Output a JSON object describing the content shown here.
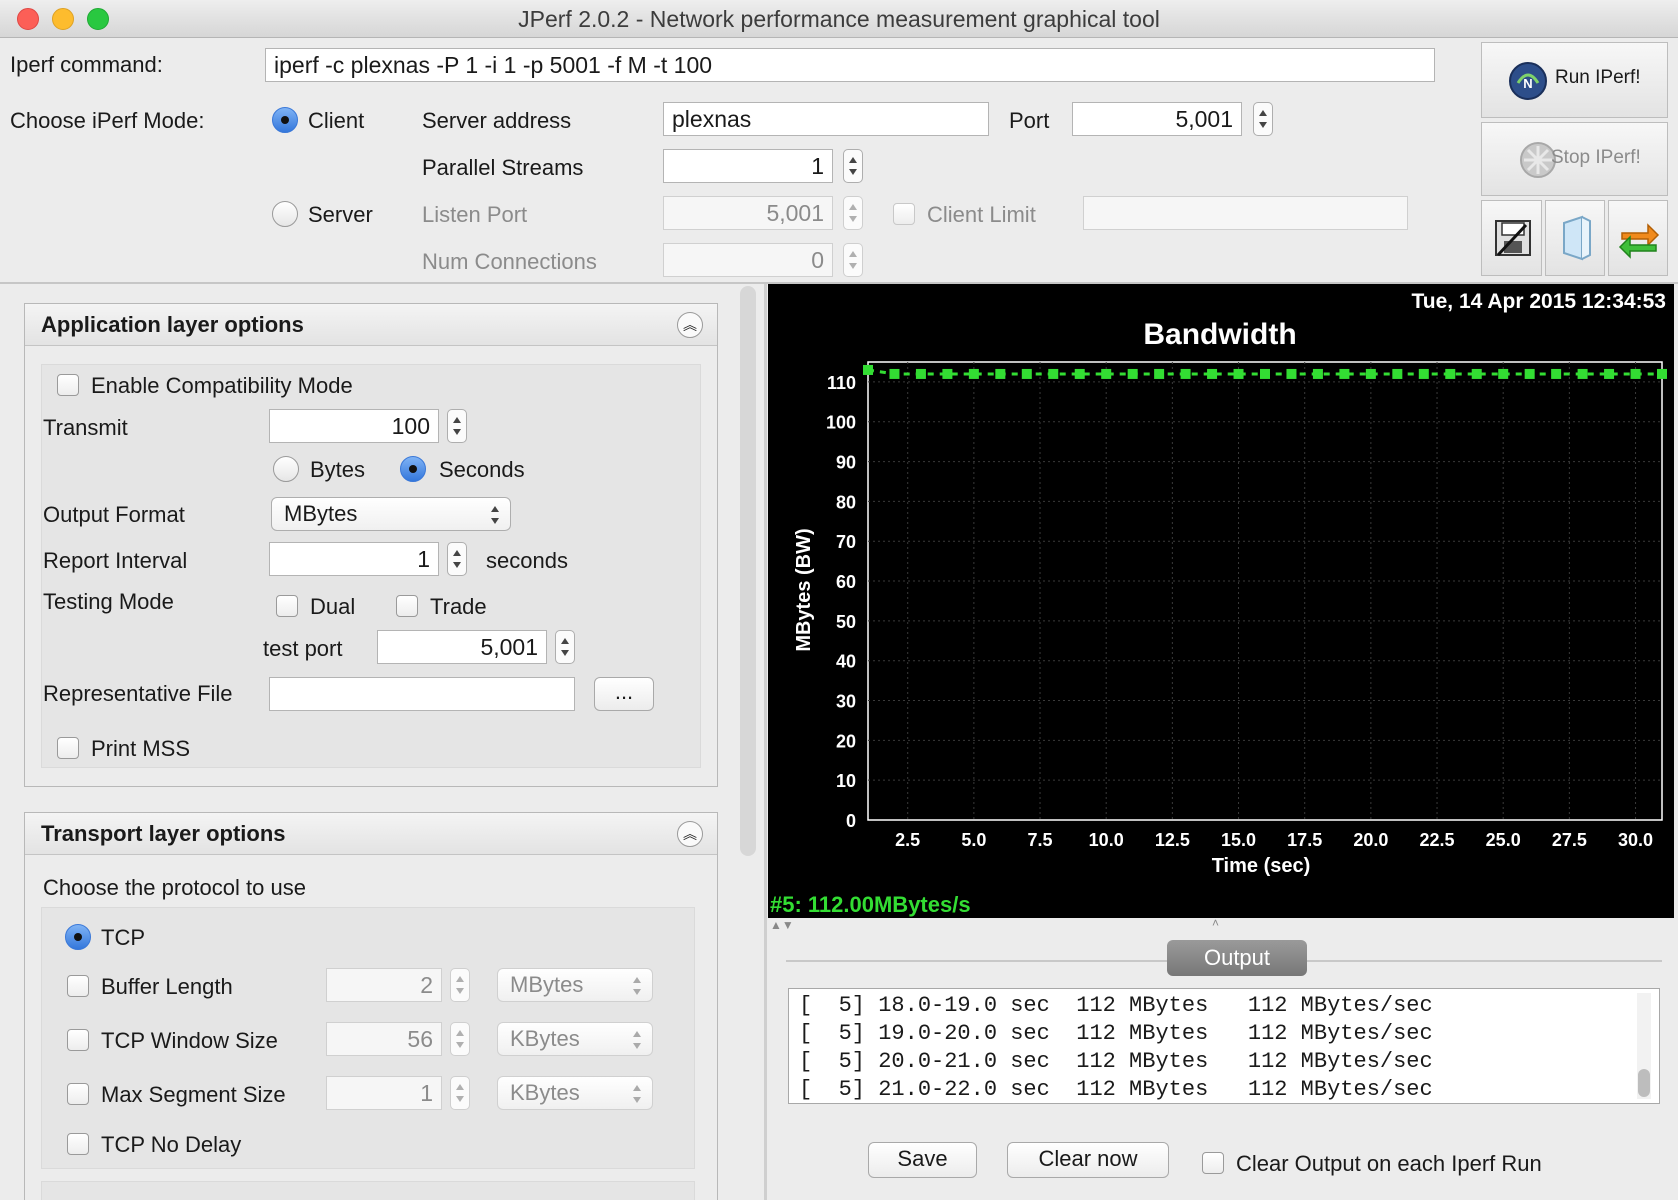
{
  "window": {
    "title": "JPerf 2.0.2 - Network performance measurement graphical tool"
  },
  "command": {
    "label": "Iperf command:",
    "value": "iperf -c plexnas -P 1 -i 1 -p 5001 -f M -t 100"
  },
  "mode": {
    "label": "Choose iPerf Mode:",
    "client_label": "Client",
    "server_label": "Server",
    "server_address_label": "Server address",
    "server_address": "plexnas",
    "port_label": "Port",
    "port": "5,001",
    "parallel_label": "Parallel Streams",
    "parallel": "1",
    "listen_port_label": "Listen Port",
    "listen_port": "5,001",
    "client_limit_label": "Client Limit",
    "client_limit": "",
    "num_conn_label": "Num Connections",
    "num_conn": "0"
  },
  "actions": {
    "run": "Run IPerf!",
    "stop": "Stop IPerf!"
  },
  "icons": {
    "run": "iperf-run-icon",
    "stop": "iperf-stop-icon",
    "save": "save-config-icon",
    "open": "open-config-icon",
    "refresh": "refresh-icon"
  },
  "app_layer": {
    "title": "Application layer options",
    "compat_label": "Enable Compatibility Mode",
    "transmit_label": "Transmit",
    "transmit": "100",
    "bytes_label": "Bytes",
    "seconds_label": "Seconds",
    "output_format_label": "Output Format",
    "output_format": "MBytes",
    "report_interval_label": "Report Interval",
    "report_interval": "1",
    "seconds_unit": "seconds",
    "testing_mode_label": "Testing Mode",
    "dual_label": "Dual",
    "trade_label": "Trade",
    "test_port_label": "test port",
    "test_port": "5,001",
    "rep_file_label": "Representative File",
    "rep_file": "",
    "browse_label": "...",
    "print_mss_label": "Print MSS"
  },
  "transport_layer": {
    "title": "Transport layer options",
    "protocol_label": "Choose the protocol to use",
    "tcp_label": "TCP",
    "buffer_label": "Buffer Length",
    "buffer": "2",
    "buffer_unit": "MBytes",
    "window_label": "TCP Window Size",
    "window": "56",
    "window_unit": "KBytes",
    "mss_label": "Max Segment Size",
    "mss": "1",
    "mss_unit": "KBytes",
    "nodelay_label": "TCP No Delay"
  },
  "graph": {
    "timestamp": "Tue, 14 Apr 2015 12:34:53",
    "legend": "#5: 112.00MBytes/s",
    "series_color": "#33dd33"
  },
  "chart_data": {
    "type": "line",
    "title": "Bandwidth",
    "xlabel": "Time (sec)",
    "ylabel": "MBytes (BW)",
    "xlim": [
      1,
      31
    ],
    "ylim": [
      0,
      115
    ],
    "xticks": [
      "2.5",
      "5.0",
      "7.5",
      "10.0",
      "12.5",
      "15.0",
      "17.5",
      "20.0",
      "22.5",
      "25.0",
      "27.5",
      "30.0"
    ],
    "yticks": [
      "0",
      "10",
      "20",
      "30",
      "40",
      "50",
      "60",
      "70",
      "80",
      "90",
      "100",
      "110"
    ],
    "series": [
      {
        "name": "#5",
        "x": [
          1,
          2,
          3,
          4,
          5,
          6,
          7,
          8,
          9,
          10,
          11,
          12,
          13,
          14,
          15,
          16,
          17,
          18,
          19,
          20,
          21,
          22,
          23,
          24,
          25,
          26,
          27,
          28,
          29,
          30,
          31
        ],
        "values": [
          113,
          112,
          112,
          112,
          112,
          112,
          112,
          112,
          112,
          112,
          112,
          112,
          112,
          112,
          112,
          112,
          112,
          112,
          112,
          112,
          112,
          112,
          112,
          112,
          112,
          112,
          112,
          112,
          112,
          112,
          112
        ]
      }
    ]
  },
  "output": {
    "tab_label": "Output",
    "lines": [
      "[  5] 18.0-19.0 sec  112 MBytes   112 MBytes/sec",
      "[  5] 19.0-20.0 sec  112 MBytes   112 MBytes/sec",
      "[  5] 20.0-21.0 sec  112 MBytes   112 MBytes/sec",
      "[  5] 21.0-22.0 sec  112 MBytes   112 MBytes/sec"
    ],
    "save_label": "Save",
    "clear_label": "Clear now",
    "clear_each_label": "Clear Output on each Iperf Run"
  }
}
